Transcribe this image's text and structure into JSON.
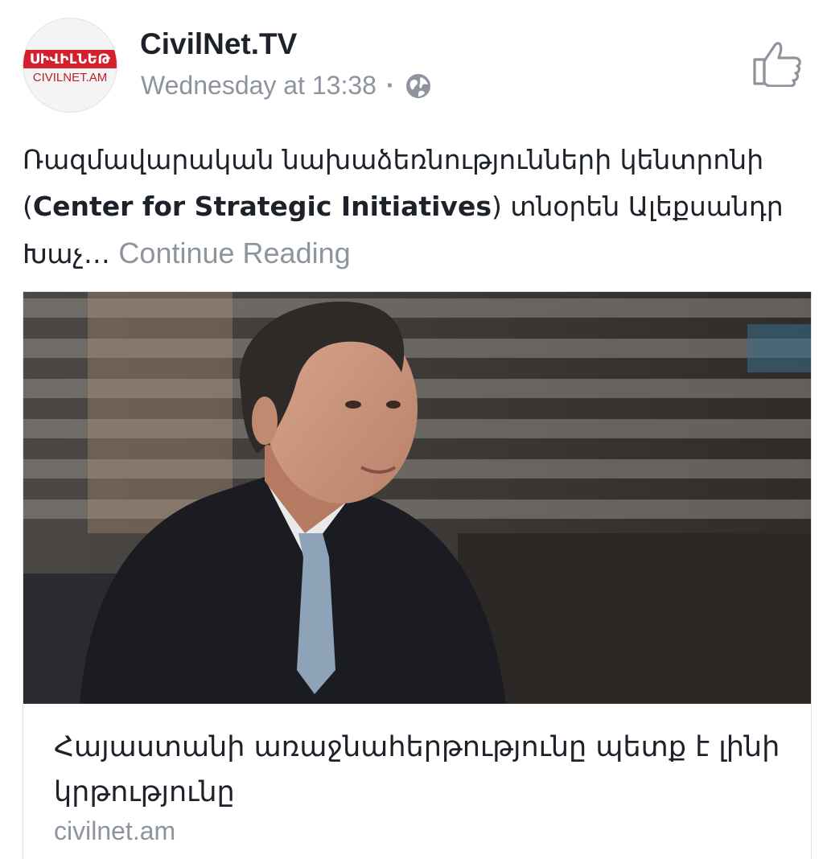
{
  "post": {
    "avatar": {
      "top_text": "ՍԻՎԻԼՆԵԹ",
      "bottom_text": "CIVILNET.AM",
      "brand_color": "#d3202c"
    },
    "page_name": "CivilNet.TV",
    "timestamp": "Wednesday at 13:38",
    "separator": "·",
    "privacy_icon": "globe-icon",
    "like_icon": "thumbs-up-icon",
    "text_part1": "Ռազմավարական նախաձեռնությունների կենտրոնի (",
    "text_bold": "Center for Strategic Initiatives",
    "text_part2": ") տնօրեն Ալեքսանդր Խաչ…",
    "continue_label": "Continue Reading"
  },
  "link_card": {
    "image_alt": "man-in-suit-interview-photo",
    "title": "Հայաստանի առաջնահերթությունը պետք է լինի կրթությունը",
    "domain": "civilnet.am"
  },
  "colors": {
    "text": "#1d2129",
    "secondary": "#8d949e",
    "border": "#dddfe2"
  }
}
